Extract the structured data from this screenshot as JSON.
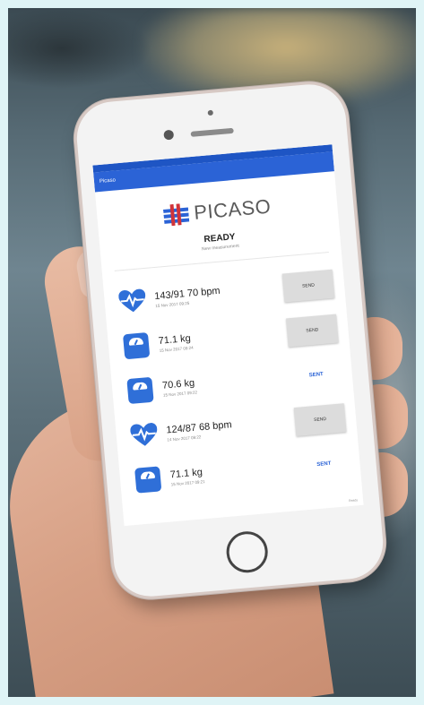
{
  "app": {
    "title": "Picaso",
    "brand": "PICASO",
    "brand_color": "#2b63d6",
    "status_title": "READY",
    "status_subtitle": "New measurement"
  },
  "measurements": [
    {
      "icon": "heart-pulse-icon",
      "value": "143/91 70 bpm",
      "date": "15 Nov 2017 09:25",
      "action": "SEND",
      "state": "button"
    },
    {
      "icon": "scale-icon",
      "value": "71.1 kg",
      "date": "15 Nov 2017 09:24",
      "action": "SEND",
      "state": "button"
    },
    {
      "icon": "scale-icon",
      "value": "70.6 kg",
      "date": "15 Nov 2017 09:22",
      "action": "SENT",
      "state": "sent"
    },
    {
      "icon": "heart-pulse-icon",
      "value": "124/87 68 bpm",
      "date": "14 Nov 2017 09:22",
      "action": "SEND",
      "state": "button"
    },
    {
      "icon": "scale-icon",
      "value": "71.1 kg",
      "date": "15 Nov 2017 09:21",
      "action": "SENT",
      "state": "sent"
    }
  ],
  "footer": {
    "version": "Ready"
  }
}
